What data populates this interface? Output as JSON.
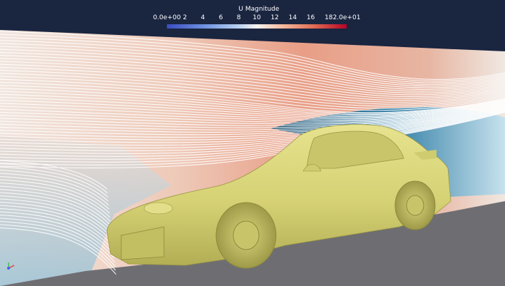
{
  "colorbar": {
    "title": "U Magnitude",
    "ticks": [
      "0.0e+00",
      "2",
      "4",
      "6",
      "8",
      "10",
      "12",
      "14",
      "16",
      "18",
      "2.0e+01"
    ],
    "range": [
      0,
      20
    ]
  },
  "colors": {
    "background": "#1a2540",
    "ground": "#6e6e72",
    "car_body": "#d8d47a",
    "streamline": "#ffffff"
  }
}
